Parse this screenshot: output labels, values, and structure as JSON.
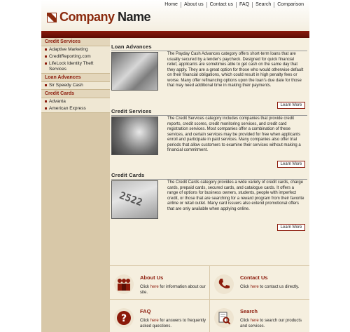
{
  "header": {
    "logo_company": "Company",
    "logo_name": " Name",
    "nav": [
      "Home",
      "About us",
      "Contact us",
      "FAQ",
      "Search",
      "Comparison"
    ]
  },
  "sidebar": {
    "categories": [
      {
        "title": "Credit Services",
        "items": [
          "Adaptive Marketing",
          "CreditReporting.com",
          "LifeLock Identity Theft Services"
        ]
      },
      {
        "title": "Loan Advances",
        "items": [
          "Sir Speedy Cash"
        ]
      },
      {
        "title": "Credit Cards",
        "items": [
          "Advanta",
          "American Express"
        ]
      }
    ]
  },
  "sections": [
    {
      "title": "Loan Advances",
      "text": "The Payday Cash Advances category offers short-term loans that are usually secured by a lender's paycheck. Designed for quick financial relief, applicants are sometimes able to get cash on the same day that they apply. They are a great option for those who would otherwise default on their financial obligations, which could result in high penalty fees or worse. Many offer refinancing options upon the loan's due date for those that may need additional time in making their payments.",
      "button": "Learn More"
    },
    {
      "title": "Credit Services",
      "text": "The Credit Services category includes companies that provide credit reports, credit scores, credit monitoring services, and credit card registration services. Most companies offer a combination of these services, and certain services may be provided for free when applicants enroll and participate in paid services. Many companies also offer trial periods that allow customers to examine their services without making a financial commitment.",
      "button": "Learn More"
    },
    {
      "title": "Credit Cards",
      "text": "The Credit Cards category provides a wide variety of credit cards, charge cards, prepaid cards, secured cards, and catalogue cards. It offers a range of options for business owners, students, people with imperfect credit, or those that are searching for a reward program from their favorite airline or retail outlet. Many card issuers also extend promotional offers that are only available when applying online.",
      "button": "Learn More",
      "image_digits": "2522"
    }
  ],
  "bottom": [
    {
      "title": "About Us",
      "pre": "Click ",
      "link": "here",
      "post": " for information about our site.",
      "icon": "people-icon"
    },
    {
      "title": "Contact Us",
      "pre": "Click ",
      "link": "here",
      "post": " to contact us directly.",
      "icon": "phone-icon"
    },
    {
      "title": "FAQ",
      "pre": "Click ",
      "link": "here",
      "post": " for answers to frequently asked questions.",
      "icon": "question-icon"
    },
    {
      "title": "Search",
      "pre": "Click ",
      "link": "here",
      "post": " to search our products and services.",
      "icon": "document-search-icon"
    }
  ],
  "colors": {
    "accent": "#8b1a0a",
    "sidebar": "#d8c8a8",
    "content": "#f5efdf"
  }
}
